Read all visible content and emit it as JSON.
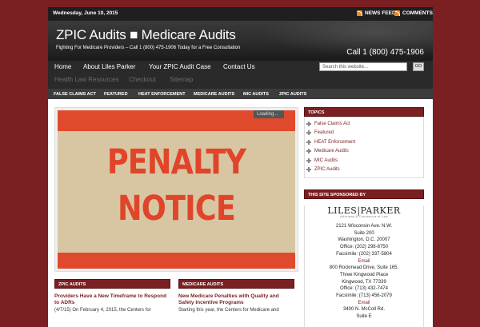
{
  "topbar": {
    "date": "Wednesday, June 10, 2015",
    "news_feed": "NEWS FEED",
    "comments": "COMMENTS"
  },
  "header": {
    "title": "ZPIC Audits ■ Medicare Audits",
    "tagline": "Fighting For Medicare Providers – Call 1 (800) 475-1906 Today for a Free Consultation",
    "phone": "Call 1 (800) 475-1906"
  },
  "nav": {
    "items": [
      "Home",
      "About Liles Parker",
      "Your ZPIC Audit Case",
      "Contact Us"
    ],
    "search_placeholder": "Search this website...",
    "go": "GO"
  },
  "nav2": {
    "items": [
      "Health Law Resources",
      "Checkout",
      "Sitemap"
    ]
  },
  "cats": {
    "items": [
      "FALSE CLAIMS ACT",
      "FEATURED",
      "HEAT ENFORCEMENT",
      "MEDICARE AUDITS",
      "MIC AUDITS",
      "ZPIC AUDITS"
    ]
  },
  "slider": {
    "line1": "PENALTY",
    "line2": "NOTICE",
    "loading": "Loading..."
  },
  "posts": [
    {
      "heading": "ZPIC AUDITS",
      "title": "Providers Have a New Timeframe to Respond to ADRs",
      "text": "(4/7/15) On February 4, 2015, the Centers for"
    },
    {
      "heading": "MEDICARE AUDITS",
      "title": "New Medicare Penalties with Quality and Safety Incentive Programs",
      "text": "Starting this year, the Centers for Medicare and"
    }
  ],
  "sidebar": {
    "topics_heading": "TOPICS",
    "topics": [
      "False Claims Act",
      "Featured",
      "HEAT Enforcement",
      "Medicare Audits",
      "MIC Audits",
      "ZPIC Audits"
    ],
    "sponsor_heading": "THIS SITE SPONSORED BY",
    "logo": "LILES|PARKER",
    "logo_sub": "Attorneys & Counselors at Law",
    "address": [
      "2121 Wisconsin Ave. N.W.",
      "Suite 200",
      "Washington, D.C. 20007",
      "Office: (202) 298-8750",
      "Facsimile: (202) 337-5804",
      "Email",
      "800 Rockmead Drive, Suite 165,",
      "Three Kingwood Place",
      "Kingwood, TX 77339",
      "Office: (713) 432-7474",
      "Facsimile: (713) 456-2079",
      "Email",
      "3400 N. McColl Rd.",
      "Suite E"
    ]
  },
  "colors": {
    "brand": "#7a1f22",
    "header": "#2b2b2b",
    "poster_red": "#e0452a",
    "poster_bg": "#d8c6a3"
  }
}
